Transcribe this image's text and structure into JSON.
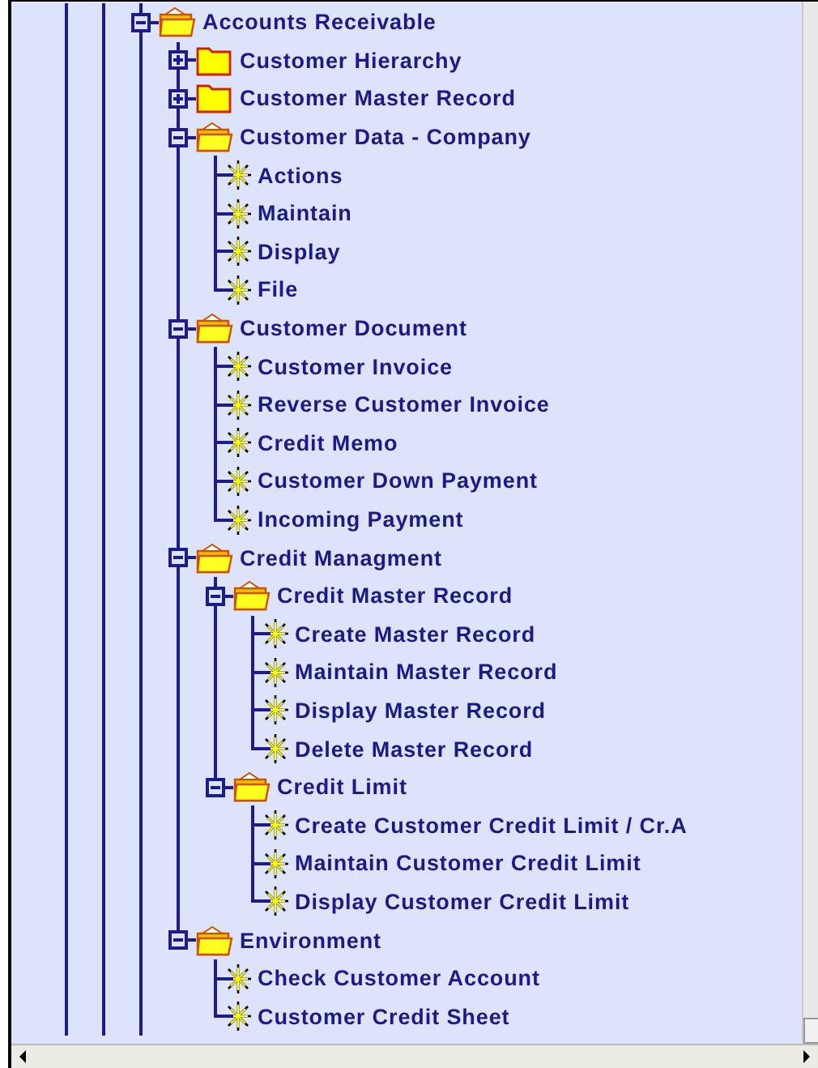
{
  "tree": [
    {
      "label": "Accounts Receivable",
      "kind": "folder",
      "expanded": true,
      "children": [
        {
          "label": "Customer Hierarchy",
          "kind": "folder",
          "expanded": false
        },
        {
          "label": "Customer Master Record",
          "kind": "folder",
          "expanded": false
        },
        {
          "label": "Customer Data - Company",
          "kind": "folder",
          "expanded": true,
          "children": [
            {
              "label": "Actions",
              "kind": "transaction"
            },
            {
              "label": "Maintain",
              "kind": "transaction"
            },
            {
              "label": "Display",
              "kind": "transaction"
            },
            {
              "label": "File",
              "kind": "transaction"
            }
          ]
        },
        {
          "label": "Customer Document",
          "kind": "folder",
          "expanded": true,
          "children": [
            {
              "label": "Customer Invoice",
              "kind": "transaction"
            },
            {
              "label": "Reverse Customer Invoice",
              "kind": "transaction"
            },
            {
              "label": "Credit Memo",
              "kind": "transaction"
            },
            {
              "label": "Customer Down Payment",
              "kind": "transaction"
            },
            {
              "label": "Incoming Payment",
              "kind": "transaction"
            }
          ]
        },
        {
          "label": "Credit Managment",
          "kind": "folder",
          "expanded": true,
          "children": [
            {
              "label": "Credit Master Record",
              "kind": "folder",
              "expanded": true,
              "children": [
                {
                  "label": "Create Master Record",
                  "kind": "transaction"
                },
                {
                  "label": "Maintain Master Record",
                  "kind": "transaction"
                },
                {
                  "label": "Display Master Record",
                  "kind": "transaction"
                },
                {
                  "label": "Delete Master Record",
                  "kind": "transaction"
                }
              ]
            },
            {
              "label": "Credit Limit",
              "kind": "folder",
              "expanded": true,
              "children": [
                {
                  "label": "Create Customer Credit Limit / Cr.A",
                  "kind": "transaction"
                },
                {
                  "label": "Maintain Customer Credit Limit",
                  "kind": "transaction"
                },
                {
                  "label": "Display Customer Credit Limit",
                  "kind": "transaction"
                }
              ]
            }
          ]
        },
        {
          "label": "Environment",
          "kind": "folder",
          "expanded": true,
          "children": [
            {
              "label": "Check Customer Account",
              "kind": "transaction"
            },
            {
              "label": "Customer Credit Sheet",
              "kind": "transaction"
            }
          ]
        }
      ]
    }
  ]
}
